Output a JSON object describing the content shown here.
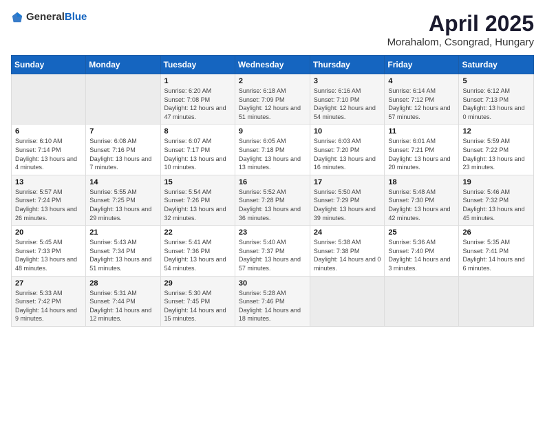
{
  "header": {
    "logo_general": "General",
    "logo_blue": "Blue",
    "title": "April 2025",
    "subtitle": "Morahalom, Csongrad, Hungary"
  },
  "weekdays": [
    "Sunday",
    "Monday",
    "Tuesday",
    "Wednesday",
    "Thursday",
    "Friday",
    "Saturday"
  ],
  "weeks": [
    [
      {
        "day": "",
        "sunrise": "",
        "sunset": "",
        "daylight": ""
      },
      {
        "day": "",
        "sunrise": "",
        "sunset": "",
        "daylight": ""
      },
      {
        "day": "1",
        "sunrise": "Sunrise: 6:20 AM",
        "sunset": "Sunset: 7:08 PM",
        "daylight": "Daylight: 12 hours and 47 minutes."
      },
      {
        "day": "2",
        "sunrise": "Sunrise: 6:18 AM",
        "sunset": "Sunset: 7:09 PM",
        "daylight": "Daylight: 12 hours and 51 minutes."
      },
      {
        "day": "3",
        "sunrise": "Sunrise: 6:16 AM",
        "sunset": "Sunset: 7:10 PM",
        "daylight": "Daylight: 12 hours and 54 minutes."
      },
      {
        "day": "4",
        "sunrise": "Sunrise: 6:14 AM",
        "sunset": "Sunset: 7:12 PM",
        "daylight": "Daylight: 12 hours and 57 minutes."
      },
      {
        "day": "5",
        "sunrise": "Sunrise: 6:12 AM",
        "sunset": "Sunset: 7:13 PM",
        "daylight": "Daylight: 13 hours and 0 minutes."
      }
    ],
    [
      {
        "day": "6",
        "sunrise": "Sunrise: 6:10 AM",
        "sunset": "Sunset: 7:14 PM",
        "daylight": "Daylight: 13 hours and 4 minutes."
      },
      {
        "day": "7",
        "sunrise": "Sunrise: 6:08 AM",
        "sunset": "Sunset: 7:16 PM",
        "daylight": "Daylight: 13 hours and 7 minutes."
      },
      {
        "day": "8",
        "sunrise": "Sunrise: 6:07 AM",
        "sunset": "Sunset: 7:17 PM",
        "daylight": "Daylight: 13 hours and 10 minutes."
      },
      {
        "day": "9",
        "sunrise": "Sunrise: 6:05 AM",
        "sunset": "Sunset: 7:18 PM",
        "daylight": "Daylight: 13 hours and 13 minutes."
      },
      {
        "day": "10",
        "sunrise": "Sunrise: 6:03 AM",
        "sunset": "Sunset: 7:20 PM",
        "daylight": "Daylight: 13 hours and 16 minutes."
      },
      {
        "day": "11",
        "sunrise": "Sunrise: 6:01 AM",
        "sunset": "Sunset: 7:21 PM",
        "daylight": "Daylight: 13 hours and 20 minutes."
      },
      {
        "day": "12",
        "sunrise": "Sunrise: 5:59 AM",
        "sunset": "Sunset: 7:22 PM",
        "daylight": "Daylight: 13 hours and 23 minutes."
      }
    ],
    [
      {
        "day": "13",
        "sunrise": "Sunrise: 5:57 AM",
        "sunset": "Sunset: 7:24 PM",
        "daylight": "Daylight: 13 hours and 26 minutes."
      },
      {
        "day": "14",
        "sunrise": "Sunrise: 5:55 AM",
        "sunset": "Sunset: 7:25 PM",
        "daylight": "Daylight: 13 hours and 29 minutes."
      },
      {
        "day": "15",
        "sunrise": "Sunrise: 5:54 AM",
        "sunset": "Sunset: 7:26 PM",
        "daylight": "Daylight: 13 hours and 32 minutes."
      },
      {
        "day": "16",
        "sunrise": "Sunrise: 5:52 AM",
        "sunset": "Sunset: 7:28 PM",
        "daylight": "Daylight: 13 hours and 36 minutes."
      },
      {
        "day": "17",
        "sunrise": "Sunrise: 5:50 AM",
        "sunset": "Sunset: 7:29 PM",
        "daylight": "Daylight: 13 hours and 39 minutes."
      },
      {
        "day": "18",
        "sunrise": "Sunrise: 5:48 AM",
        "sunset": "Sunset: 7:30 PM",
        "daylight": "Daylight: 13 hours and 42 minutes."
      },
      {
        "day": "19",
        "sunrise": "Sunrise: 5:46 AM",
        "sunset": "Sunset: 7:32 PM",
        "daylight": "Daylight: 13 hours and 45 minutes."
      }
    ],
    [
      {
        "day": "20",
        "sunrise": "Sunrise: 5:45 AM",
        "sunset": "Sunset: 7:33 PM",
        "daylight": "Daylight: 13 hours and 48 minutes."
      },
      {
        "day": "21",
        "sunrise": "Sunrise: 5:43 AM",
        "sunset": "Sunset: 7:34 PM",
        "daylight": "Daylight: 13 hours and 51 minutes."
      },
      {
        "day": "22",
        "sunrise": "Sunrise: 5:41 AM",
        "sunset": "Sunset: 7:36 PM",
        "daylight": "Daylight: 13 hours and 54 minutes."
      },
      {
        "day": "23",
        "sunrise": "Sunrise: 5:40 AM",
        "sunset": "Sunset: 7:37 PM",
        "daylight": "Daylight: 13 hours and 57 minutes."
      },
      {
        "day": "24",
        "sunrise": "Sunrise: 5:38 AM",
        "sunset": "Sunset: 7:38 PM",
        "daylight": "Daylight: 14 hours and 0 minutes."
      },
      {
        "day": "25",
        "sunrise": "Sunrise: 5:36 AM",
        "sunset": "Sunset: 7:40 PM",
        "daylight": "Daylight: 14 hours and 3 minutes."
      },
      {
        "day": "26",
        "sunrise": "Sunrise: 5:35 AM",
        "sunset": "Sunset: 7:41 PM",
        "daylight": "Daylight: 14 hours and 6 minutes."
      }
    ],
    [
      {
        "day": "27",
        "sunrise": "Sunrise: 5:33 AM",
        "sunset": "Sunset: 7:42 PM",
        "daylight": "Daylight: 14 hours and 9 minutes."
      },
      {
        "day": "28",
        "sunrise": "Sunrise: 5:31 AM",
        "sunset": "Sunset: 7:44 PM",
        "daylight": "Daylight: 14 hours and 12 minutes."
      },
      {
        "day": "29",
        "sunrise": "Sunrise: 5:30 AM",
        "sunset": "Sunset: 7:45 PM",
        "daylight": "Daylight: 14 hours and 15 minutes."
      },
      {
        "day": "30",
        "sunrise": "Sunrise: 5:28 AM",
        "sunset": "Sunset: 7:46 PM",
        "daylight": "Daylight: 14 hours and 18 minutes."
      },
      {
        "day": "",
        "sunrise": "",
        "sunset": "",
        "daylight": ""
      },
      {
        "day": "",
        "sunrise": "",
        "sunset": "",
        "daylight": ""
      },
      {
        "day": "",
        "sunrise": "",
        "sunset": "",
        "daylight": ""
      }
    ]
  ]
}
